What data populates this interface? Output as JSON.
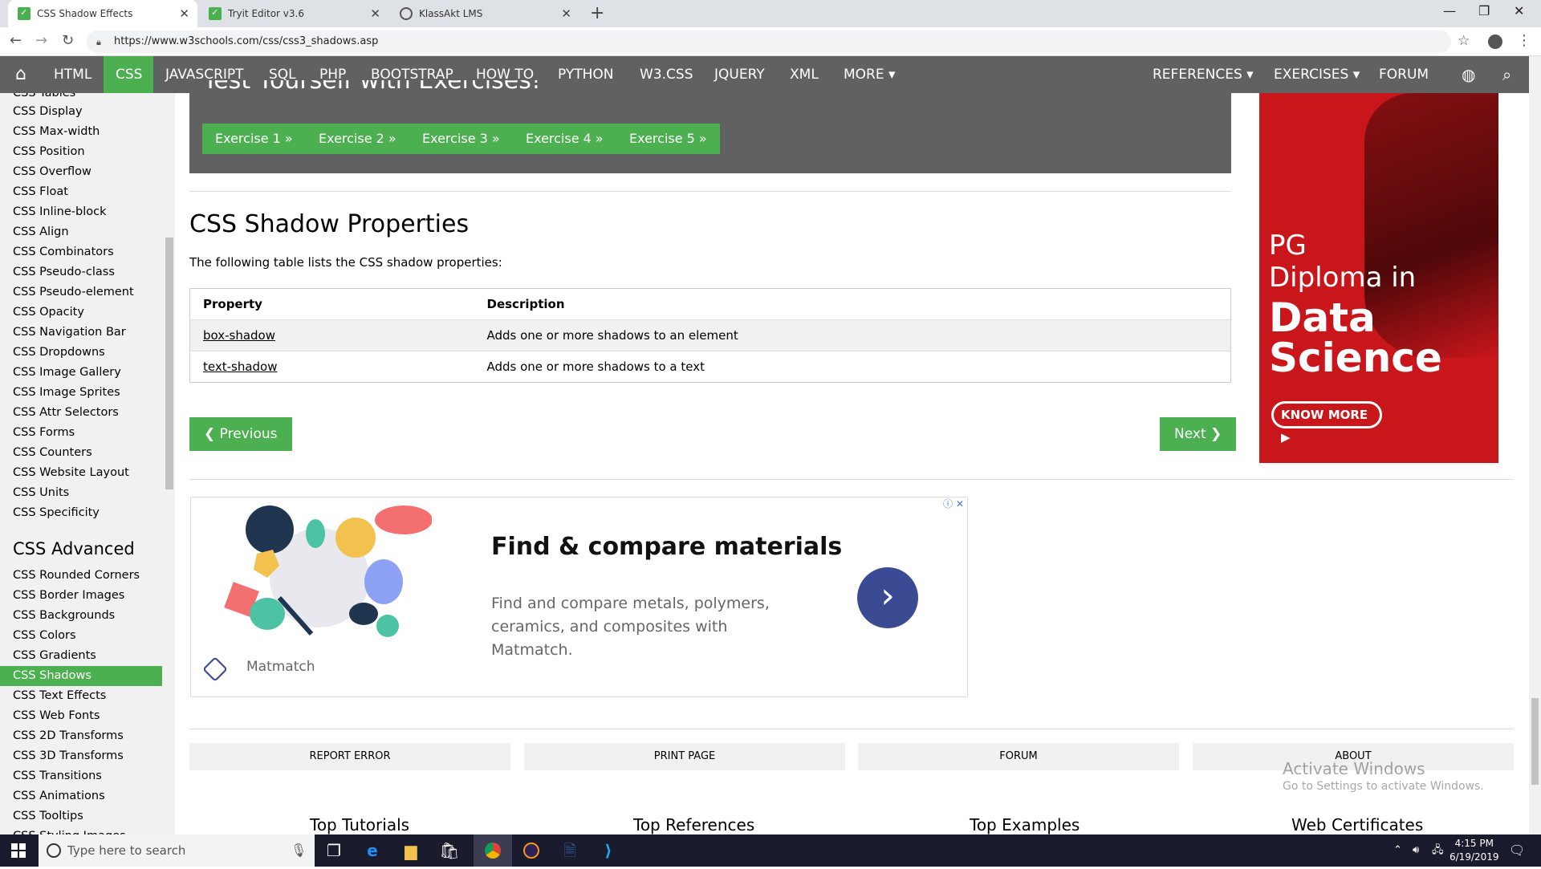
{
  "browser": {
    "tabs": [
      {
        "title": "CSS Shadow Effects",
        "icon": "w3schools-icon",
        "active": true
      },
      {
        "title": "Tryit Editor v3.6",
        "icon": "w3schools-icon",
        "active": false
      },
      {
        "title": "KlassAkt LMS",
        "icon": "globe-icon",
        "active": false
      }
    ],
    "url": "https://www.w3schools.com/css/css3_shadows.asp"
  },
  "topnav": {
    "items": [
      "HTML",
      "CSS",
      "JAVASCRIPT",
      "SQL",
      "PHP",
      "BOOTSTRAP",
      "HOW TO",
      "PYTHON",
      "W3.CSS",
      "JQUERY",
      "XML",
      "MORE ▾"
    ],
    "active": "CSS",
    "right": [
      "REFERENCES ▾",
      "EXERCISES ▾",
      "FORUM"
    ]
  },
  "sidebar": {
    "items_top": [
      "CSS Tables",
      "CSS Display",
      "CSS Max-width",
      "CSS Position",
      "CSS Overflow",
      "CSS Float",
      "CSS Inline-block",
      "CSS Align",
      "CSS Combinators",
      "CSS Pseudo-class",
      "CSS Pseudo-element",
      "CSS Opacity",
      "CSS Navigation Bar",
      "CSS Dropdowns",
      "CSS Image Gallery",
      "CSS Image Sprites",
      "CSS Attr Selectors",
      "CSS Forms",
      "CSS Counters",
      "CSS Website Layout",
      "CSS Units",
      "CSS Specificity"
    ],
    "advanced_heading": "CSS Advanced",
    "items_advanced": [
      "CSS Rounded Corners",
      "CSS Border Images",
      "CSS Backgrounds",
      "CSS Colors",
      "CSS Gradients",
      "CSS Shadows",
      "CSS Text Effects",
      "CSS Web Fonts",
      "CSS 2D Transforms",
      "CSS 3D Transforms",
      "CSS Transitions",
      "CSS Animations",
      "CSS Tooltips",
      "CSS Styling Images"
    ],
    "active": "CSS Shadows"
  },
  "main": {
    "exercise_title": "Test Yourself with Exercises!",
    "exercises": [
      "Exercise 1 »",
      "Exercise 2 »",
      "Exercise 3 »",
      "Exercise 4 »",
      "Exercise 5 »"
    ],
    "heading": "CSS Shadow Properties",
    "intro": "The following table lists the CSS shadow properties:",
    "table": {
      "headers": [
        "Property",
        "Description"
      ],
      "rows": [
        [
          "box-shadow",
          "Adds one or more shadows to an element"
        ],
        [
          "text-shadow",
          "Adds one or more shadows to a text"
        ]
      ]
    },
    "prev_label": "❮ Previous",
    "next_label": "Next ❯"
  },
  "ad": {
    "title": "Find & compare materials",
    "text": "Find and compare metals, polymers, ceramics, and composites with Matmatch.",
    "brand": "Matmatch"
  },
  "side_ad": {
    "line1": "PG",
    "line2": "Diploma in",
    "line3": "Data",
    "line4": "Science",
    "button": "KNOW MORE ▶",
    "color": "#c8161b"
  },
  "footer": {
    "buttons": [
      "REPORT ERROR",
      "PRINT PAGE",
      "FORUM",
      "ABOUT"
    ],
    "titles": [
      "Top Tutorials",
      "Top References",
      "Top Examples",
      "Web Certificates"
    ]
  },
  "watermark": {
    "line1": "Activate Windows",
    "line2": "Go to Settings to activate Windows."
  },
  "taskbar": {
    "search_placeholder": "Type here to search",
    "time": "4:15 PM",
    "date": "6/19/2019"
  },
  "colors": {
    "accent": "#4caf50",
    "nav": "#616161"
  }
}
